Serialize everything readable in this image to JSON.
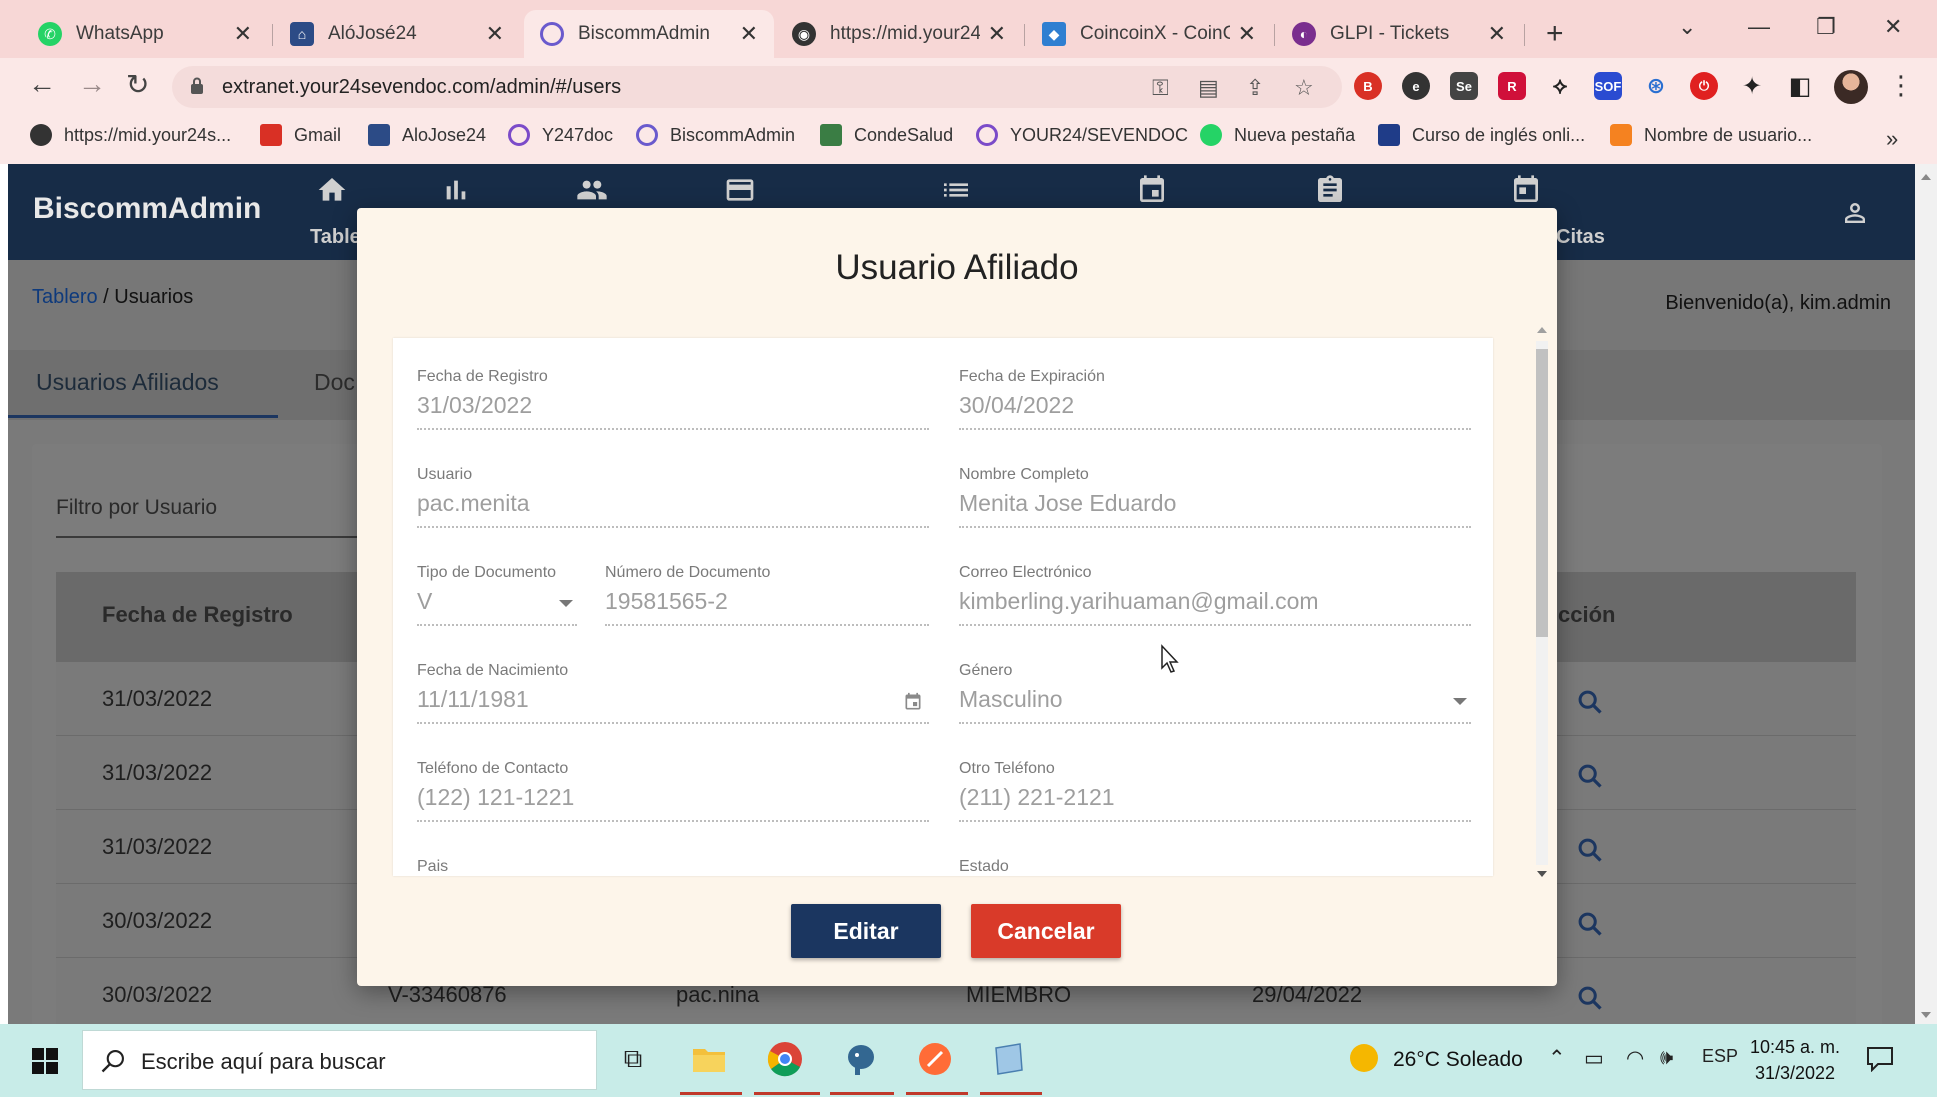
{
  "browser": {
    "tabs": [
      {
        "title": "WhatsApp",
        "icon": "whatsapp-icon",
        "color": "#25d366"
      },
      {
        "title": "AlóJosé24",
        "icon": "alojose-icon",
        "color": "#2c4b86"
      },
      {
        "title": "BiscommAdmin",
        "icon": "biscomm-icon",
        "color": "#6a5acd"
      },
      {
        "title": "https://mid.your24",
        "icon": "globe-icon",
        "color": "#333333"
      },
      {
        "title": "CoincoinX - CoinCo",
        "icon": "coincoin-icon",
        "color": "#2f7fd1"
      },
      {
        "title": "GLPI - Tickets",
        "icon": "glpi-icon",
        "color": "#7a2e8e"
      }
    ],
    "url": "extranet.your24sevendoc.com/admin/#/users",
    "bookmarks": [
      {
        "label": "https://mid.your24s...",
        "color": "#333333"
      },
      {
        "label": "Gmail",
        "color": "#d93025"
      },
      {
        "label": "AloJose24",
        "color": "#2c4b86"
      },
      {
        "label": "Y247doc",
        "color": "#7b4bc9"
      },
      {
        "label": "BiscommAdmin",
        "color": "#6a5acd"
      },
      {
        "label": "CondeSalud",
        "color": "#3a7d44"
      },
      {
        "label": "YOUR24/SEVENDOC",
        "color": "#7b4bc9"
      },
      {
        "label": "Nueva pestaña",
        "color": "#25d366"
      },
      {
        "label": "Curso de inglés onli...",
        "color": "#1f3c88"
      },
      {
        "label": "Nombre de usuario...",
        "color": "#f58220"
      }
    ]
  },
  "app": {
    "brand": "BiscommAdmin",
    "nav": [
      {
        "label": "Table",
        "icon": "home-icon"
      },
      {
        "label": "",
        "icon": "bar-chart-icon"
      },
      {
        "label": "",
        "icon": "people-icon"
      },
      {
        "label": "",
        "icon": "credit-card-icon"
      },
      {
        "label": "",
        "icon": "list-icon"
      },
      {
        "label": "",
        "icon": "calendar-icon"
      },
      {
        "label": "",
        "icon": "clipboard-icon"
      },
      {
        "label": "Citas",
        "icon": "event-icon"
      }
    ],
    "breadcrumb": {
      "home": "Tablero",
      "separator": " / ",
      "current": "Usuarios"
    },
    "welcome": "Bienvenido(a), kim.admin",
    "page_tabs": [
      "Usuarios Afiliados",
      "Doc"
    ],
    "filter_label": "Filtro por Usuario",
    "table": {
      "headers": [
        "Fecha de Registro",
        "cción"
      ],
      "rows": [
        {
          "date": "31/03/2022"
        },
        {
          "date": "31/03/2022"
        },
        {
          "date": "31/03/2022"
        },
        {
          "date": "30/03/2022"
        },
        {
          "date": "30/03/2022",
          "doc": "V-33460876",
          "user": "pac.nina",
          "role": "MIEMBRO",
          "expiry": "29/04/2022"
        }
      ]
    }
  },
  "modal": {
    "title": "Usuario Afiliado",
    "fields": {
      "fecha_registro": {
        "label": "Fecha de Registro",
        "value": "31/03/2022"
      },
      "fecha_expiracion": {
        "label": "Fecha de Expiración",
        "value": "30/04/2022"
      },
      "usuario": {
        "label": "Usuario",
        "value": "pac.menita"
      },
      "nombre_completo": {
        "label": "Nombre Completo",
        "value": "Menita Jose Eduardo"
      },
      "tipo_documento": {
        "label": "Tipo de Documento",
        "value": "V"
      },
      "numero_documento": {
        "label": "Número de Documento",
        "value": "19581565-2"
      },
      "correo": {
        "label": "Correo Electrónico",
        "value": "kimberling.yarihuaman@gmail.com"
      },
      "fecha_nacimiento": {
        "label": "Fecha de Nacimiento",
        "value": "11/11/1981"
      },
      "genero": {
        "label": "Género",
        "value": "Masculino"
      },
      "telefono": {
        "label": "Teléfono de Contacto",
        "value": "(122) 121-1221"
      },
      "otro_telefono": {
        "label": "Otro Teléfono",
        "value": "(211) 221-2121"
      },
      "pais": {
        "label": "Pais",
        "value": ""
      },
      "estado": {
        "label": "Estado",
        "value": ""
      }
    },
    "buttons": {
      "edit": "Editar",
      "cancel": "Cancelar"
    },
    "colors": {
      "edit": "#1b3660",
      "cancel": "#d93a29"
    }
  },
  "taskbar": {
    "search_placeholder": "Escribe aquí para buscar",
    "weather": "26°C  Soleado",
    "language": "ESP",
    "time": "10:45 a. m.",
    "date": "31/3/2022"
  }
}
